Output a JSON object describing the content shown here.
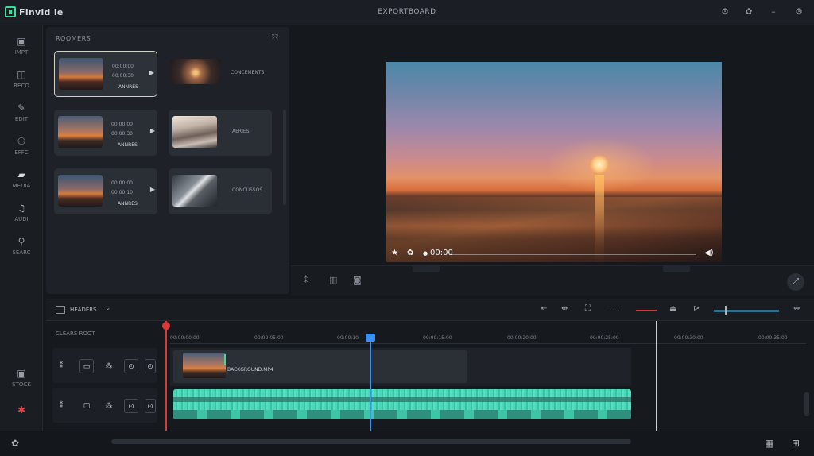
{
  "app": {
    "name": "Fi̇nvid ie",
    "project_title": "EXPORTBOARD"
  },
  "titlebar_icons": [
    "settings-icon",
    "help-icon",
    "minimize-icon",
    "close-icon"
  ],
  "sidebar": {
    "items": [
      {
        "label": "IMPT",
        "icon": "import-icon"
      },
      {
        "label": "RECO",
        "icon": "record-icon"
      },
      {
        "label": "EDIT",
        "icon": "edit-icon"
      },
      {
        "label": "EFFC",
        "icon": "effects-icon"
      },
      {
        "label": "MEDIA",
        "icon": "folder-icon"
      },
      {
        "label": "AUDI",
        "icon": "audio-icon"
      },
      {
        "label": "SEARC",
        "icon": "search-icon"
      },
      {
        "label": "STOCK",
        "icon": "stock-icon"
      }
    ]
  },
  "media": {
    "header": "ROOMERS",
    "cards": [
      {
        "meta1": "00:00:00",
        "meta2": "00:00:30",
        "meta3": "ANNRES"
      },
      {
        "caption": "CONCEMENTS"
      },
      {
        "meta1": "00:00:00",
        "meta2": "00:00:30",
        "meta3": "ANNRES"
      },
      {
        "caption": "AERIES"
      },
      {
        "meta1": "00:00:00",
        "meta2": "00:00:10",
        "meta3": "ANNRES"
      },
      {
        "caption": "CONCUSSOS"
      }
    ]
  },
  "preview": {
    "timecode": "00:00"
  },
  "timeline": {
    "name": "HEADERS",
    "label": "CLEARS ROOT",
    "ticks": [
      "00:00:00:00",
      "00:00:05:00",
      "00:00:10",
      "00:00:15:00",
      "00:00:20:00",
      "00:00:25:00",
      "00:00:30:00",
      "00:00:35:00"
    ],
    "video_clip": "BACKGROUND.MP4"
  },
  "colors": {
    "accent": "#3ddc9a",
    "audio": "#4ad8b8",
    "playhead": "#3b8ff0",
    "marker": "#d83a3a"
  }
}
